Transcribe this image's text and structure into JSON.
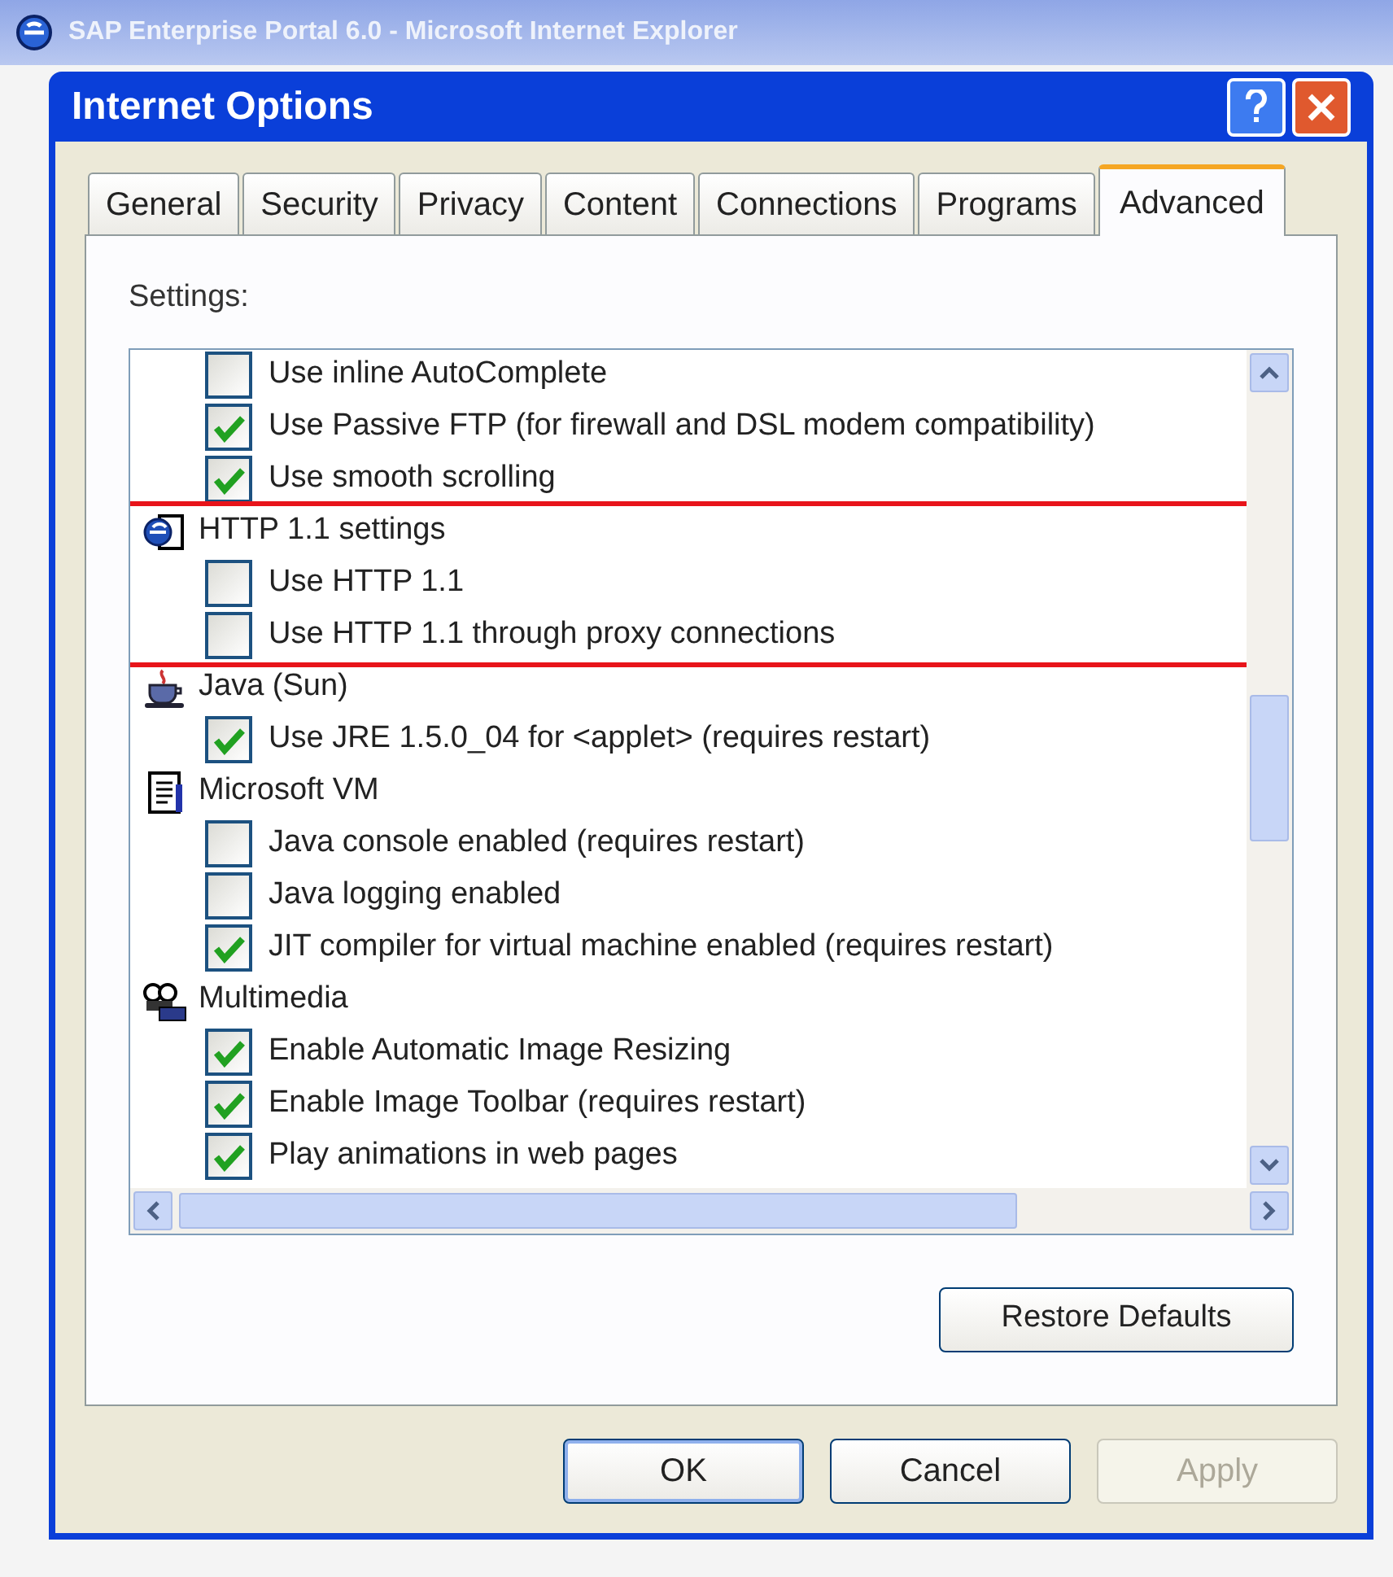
{
  "background_window": {
    "title": "SAP Enterprise Portal 6.0 - Microsoft Internet Explorer"
  },
  "window": {
    "title": "Internet Options"
  },
  "tabs": [
    {
      "label": "General",
      "selected": false
    },
    {
      "label": "Security",
      "selected": false
    },
    {
      "label": "Privacy",
      "selected": false
    },
    {
      "label": "Content",
      "selected": false
    },
    {
      "label": "Connections",
      "selected": false
    },
    {
      "label": "Programs",
      "selected": false
    },
    {
      "label": "Advanced",
      "selected": true
    }
  ],
  "settings_label": "Settings:",
  "groups": [
    {
      "items": [
        {
          "label": "Use inline AutoComplete",
          "checked": false
        },
        {
          "label": "Use Passive FTP (for firewall and DSL modem compatibility)",
          "checked": true
        },
        {
          "label": "Use smooth scrolling",
          "checked": true
        }
      ]
    },
    {
      "title": "HTTP 1.1 settings",
      "kind": "browser",
      "highlighted": true,
      "items": [
        {
          "label": "Use HTTP 1.1",
          "checked": false
        },
        {
          "label": "Use HTTP 1.1 through proxy connections",
          "checked": false
        }
      ]
    },
    {
      "title": "Java (Sun)",
      "kind": "java",
      "items": [
        {
          "label": "Use JRE 1.5.0_04 for <applet> (requires restart)",
          "checked": true
        }
      ]
    },
    {
      "title": "Microsoft VM",
      "kind": "vm",
      "items": [
        {
          "label": "Java console enabled (requires restart)",
          "checked": false
        },
        {
          "label": "Java logging enabled",
          "checked": false
        },
        {
          "label": "JIT compiler for virtual machine enabled (requires restart)",
          "checked": true
        }
      ]
    },
    {
      "title": "Multimedia",
      "kind": "multimedia",
      "items": [
        {
          "label": "Enable Automatic Image Resizing",
          "checked": true
        },
        {
          "label": "Enable Image Toolbar (requires restart)",
          "checked": true
        },
        {
          "label": "Play animations in web pages",
          "checked": true
        }
      ]
    }
  ],
  "restore_button": "Restore Defaults",
  "buttons": [
    {
      "label": "OK",
      "default": true,
      "disabled": false
    },
    {
      "label": "Cancel",
      "default": false,
      "disabled": false
    },
    {
      "label": "Apply",
      "default": false,
      "disabled": true
    }
  ]
}
